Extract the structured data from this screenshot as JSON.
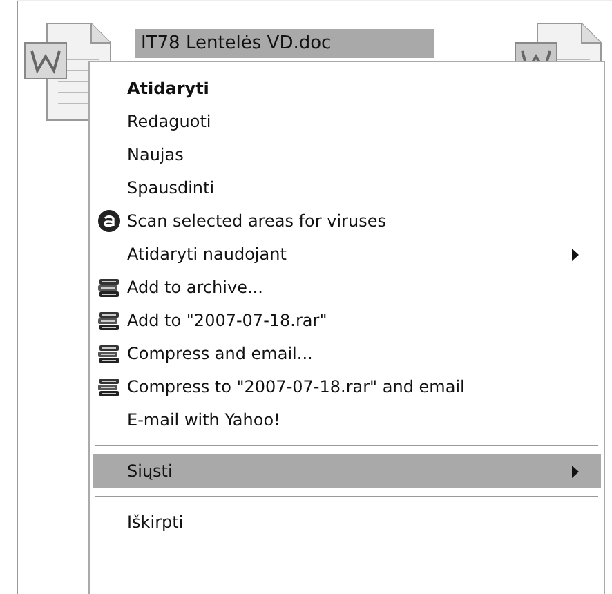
{
  "file": {
    "name": "IT78 Lentelės VD.doc",
    "selected": true
  },
  "context_menu": {
    "items": [
      {
        "kind": "plain",
        "label": "Atidaryti",
        "bold": true,
        "selected": false
      },
      {
        "kind": "plain",
        "label": "Redaguoti",
        "bold": false,
        "selected": false
      },
      {
        "kind": "plain",
        "label": "Naujas",
        "bold": false,
        "selected": false
      },
      {
        "kind": "plain",
        "label": "Spausdinti",
        "bold": false,
        "selected": false
      },
      {
        "kind": "antivirus",
        "label": "Scan selected areas for viruses",
        "bold": false,
        "selected": false
      },
      {
        "kind": "submenu",
        "label": "Atidaryti naudojant",
        "bold": false,
        "selected": false
      },
      {
        "kind": "archive",
        "label": "Add to archive...",
        "bold": false,
        "selected": false
      },
      {
        "kind": "archive",
        "label": "Add to \"2007-07-18.rar\"",
        "bold": false,
        "selected": false
      },
      {
        "kind": "archive",
        "label": "Compress and email...",
        "bold": false,
        "selected": false
      },
      {
        "kind": "archive",
        "label": "Compress to \"2007-07-18.rar\" and email",
        "bold": false,
        "selected": false
      },
      {
        "kind": "plain",
        "label": "E-mail with Yahoo!",
        "bold": false,
        "selected": false
      },
      {
        "kind": "separator"
      },
      {
        "kind": "submenu",
        "label": "Siųsti",
        "bold": false,
        "selected": true
      },
      {
        "kind": "separator"
      },
      {
        "kind": "plain",
        "label": "Iškirpti",
        "bold": false,
        "selected": false
      }
    ]
  }
}
